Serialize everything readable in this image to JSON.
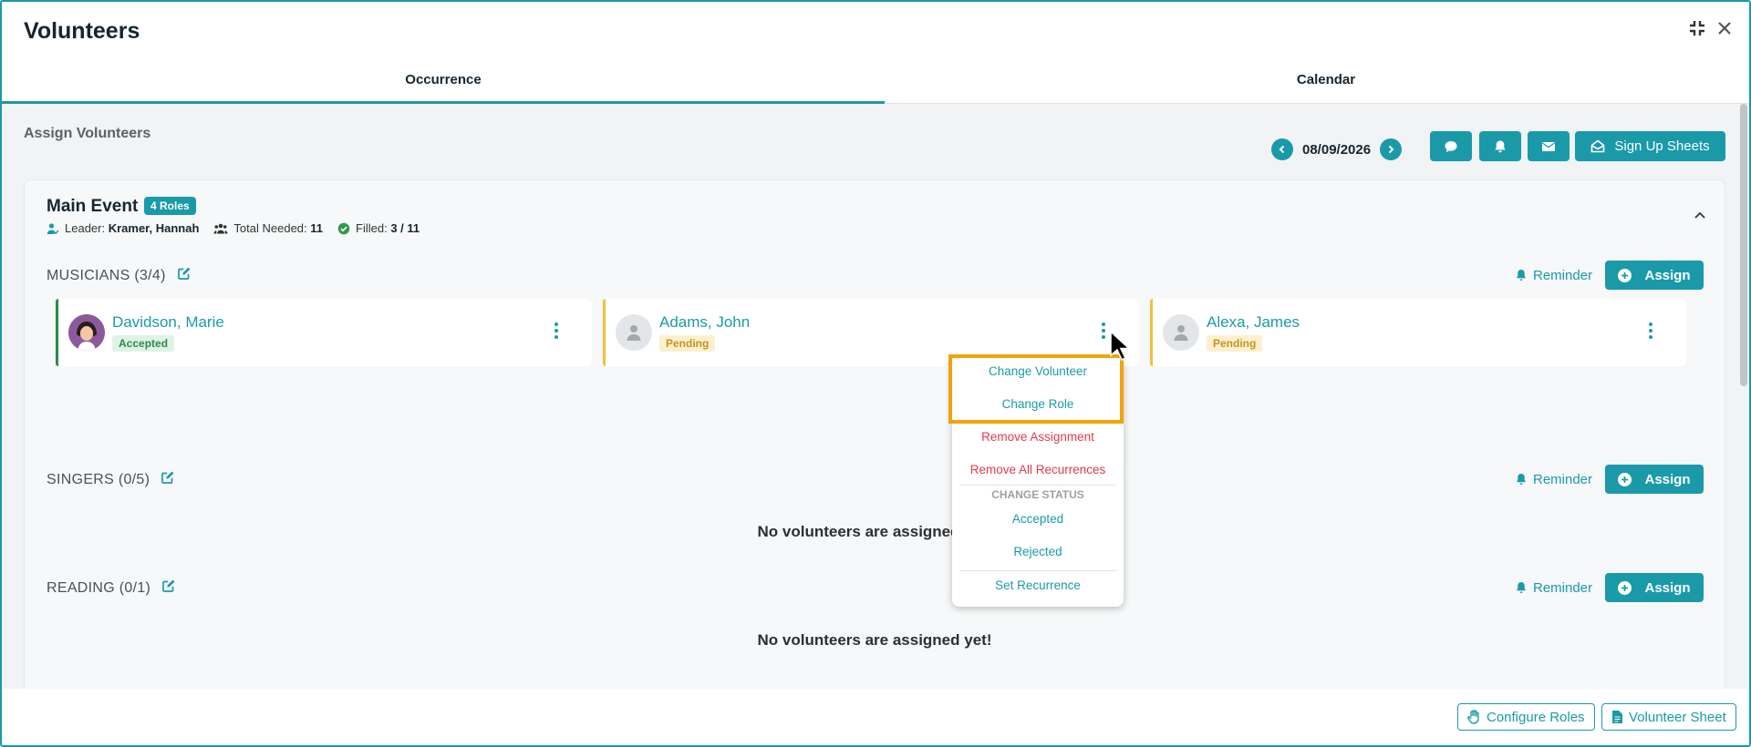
{
  "header": {
    "title": "Volunteers",
    "compress_icon": "compress-icon",
    "close_icon": "close-icon"
  },
  "tabs": [
    {
      "label": "Occurrence",
      "active": true
    },
    {
      "label": "Calendar",
      "active": false
    }
  ],
  "toolbar": {
    "section_title": "Assign Volunteers",
    "date": "08/09/2026",
    "sign_up_label": "Sign Up Sheets"
  },
  "event": {
    "name": "Main Event",
    "roles_badge": "4 Roles",
    "leader_label": "Leader:",
    "leader": "Kramer, Hannah",
    "total_label": "Total Needed:",
    "total": "11",
    "filled_label": "Filled:",
    "filled": "3 / 11"
  },
  "roles": [
    {
      "title": "MUSICIANS (3/4)",
      "reminder": "Reminder",
      "assign": "Assign"
    },
    {
      "title": "SINGERS (0/5)",
      "reminder": "Reminder",
      "assign": "Assign",
      "empty": "No volunteers are assigned yet!"
    },
    {
      "title": "READING (0/1)",
      "reminder": "Reminder",
      "assign": "Assign",
      "empty": "No volunteers are assigned yet!"
    }
  ],
  "volunteers": [
    {
      "name": "Davidson, Marie",
      "status": "Accepted"
    },
    {
      "name": "Adams, John",
      "status": "Pending"
    },
    {
      "name": "Alexa, James",
      "status": "Pending"
    }
  ],
  "menu": {
    "change_volunteer": "Change Volunteer",
    "change_role": "Change Role",
    "remove_assignment": "Remove Assignment",
    "remove_all": "Remove All Recurrences",
    "status_header": "CHANGE STATUS",
    "accepted": "Accepted",
    "rejected": "Rejected",
    "set_recurrence": "Set Recurrence"
  },
  "footer": {
    "configure_roles": "Configure Roles",
    "volunteer_sheet": "Volunteer Sheet"
  },
  "colors": {
    "accent": "#1a9aa8",
    "accepted": "#2e8a4a",
    "pending": "#f0c23a",
    "danger": "#e53950",
    "highlight": "#f0a30a"
  }
}
